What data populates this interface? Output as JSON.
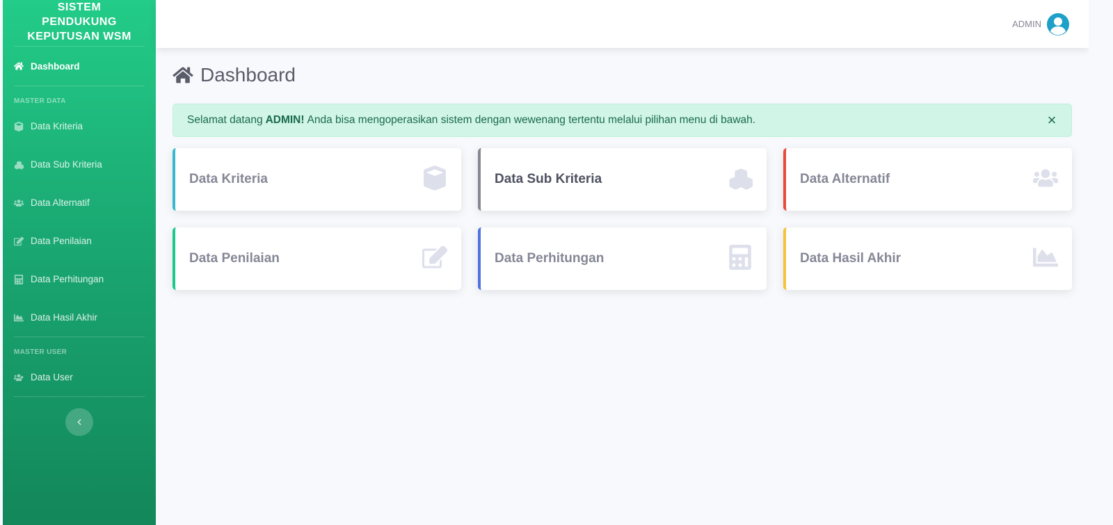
{
  "brand": {
    "line1": "SISTEM",
    "line2": "PENDUKUNG",
    "line3": "KEPUTUSAN WSM"
  },
  "sidebar": {
    "dashboard": {
      "label": "Dashboard",
      "icon": "home-icon"
    },
    "heading_master_data": "MASTER DATA",
    "items": [
      {
        "label": "Data Kriteria",
        "icon": "cube-icon"
      },
      {
        "label": "Data Sub Kriteria",
        "icon": "cubes-icon"
      },
      {
        "label": "Data Alternatif",
        "icon": "users-icon"
      },
      {
        "label": "Data Penilaian",
        "icon": "edit-icon"
      },
      {
        "label": "Data Perhitungan",
        "icon": "calculator-icon"
      },
      {
        "label": "Data Hasil Akhir",
        "icon": "chart-area-icon"
      }
    ],
    "heading_master_user": "MASTER USER",
    "user_item": {
      "label": "Data User",
      "icon": "users-cog-icon"
    },
    "toggle_icon": "chevron-left-icon"
  },
  "topbar": {
    "user_name": "ADMIN",
    "avatar_icon": "user-circle-icon"
  },
  "page": {
    "title": "Dashboard",
    "title_icon": "home-icon"
  },
  "alert": {
    "prefix": "Selamat datang",
    "bold": "ADMIN!",
    "suffix": "Anda bisa mengoperasikan sistem dengan wewenang tertentu melalui pilihan menu di bawah.",
    "close": "×"
  },
  "cards": [
    {
      "label": "Data Kriteria",
      "icon": "cube-icon",
      "accent": "#36b9cc"
    },
    {
      "label": "Data Sub Kriteria",
      "icon": "cubes-icon",
      "accent": "#858796"
    },
    {
      "label": "Data Alternatif",
      "icon": "users-icon",
      "accent": "#e74a3b"
    },
    {
      "label": "Data Penilaian",
      "icon": "edit-icon",
      "accent": "#1cc88a"
    },
    {
      "label": "Data Perhitungan",
      "icon": "calculator-icon",
      "accent": "#4e73df"
    },
    {
      "label": "Data Hasil Akhir",
      "icon": "chart-area-icon",
      "accent": "#f6c23e"
    }
  ]
}
